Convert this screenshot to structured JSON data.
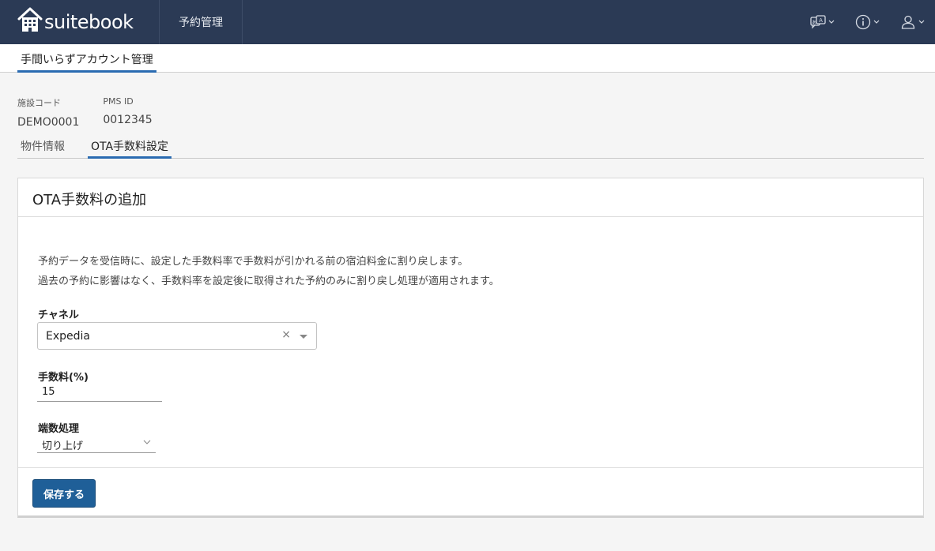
{
  "header": {
    "brand": "suitebook",
    "nav_item": "予約管理"
  },
  "icons": {
    "brand": "hotel-building-icon",
    "translate": "translate-icon",
    "info": "info-icon",
    "user": "user-icon",
    "chevron": "chevron-down-icon"
  },
  "subnav": {
    "tab": "手間いらずアカウント管理"
  },
  "property": {
    "code_label": "施設コード",
    "code_value": "DEMO0001",
    "pms_label": "PMS ID",
    "pms_value": "0012345"
  },
  "tabs": [
    {
      "label": "物件情報",
      "active": false
    },
    {
      "label": "OTA手数料設定",
      "active": true
    }
  ],
  "card": {
    "title": "OTA手数料の追加",
    "description_line1": "予約データを受信時に、設定した手数料率で手数料が引かれる前の宿泊料金に割り戻します。",
    "description_line2": "過去の予約に影響はなく、手数料率を設定後に取得された予約のみに割り戻し処理が適用されます。",
    "channel_label": "チャネル",
    "channel_value": "Expedia",
    "channel_clear": "×",
    "fee_label": "手数料(%)",
    "fee_value": "15",
    "rounding_label": "端数処理",
    "rounding_value": "切り上げ",
    "save_label": "保存する"
  },
  "colors": {
    "header_bg": "#2b3a55",
    "accent": "#2a6bb1",
    "button_bg": "#1f5f98"
  }
}
